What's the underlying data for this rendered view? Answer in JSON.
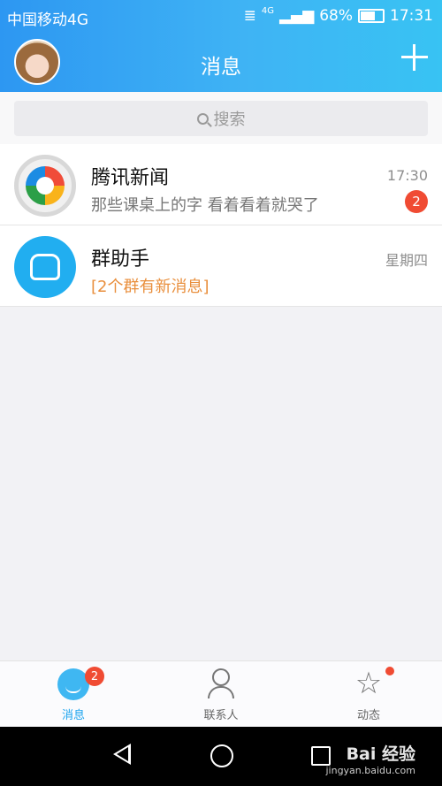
{
  "status_bar": {
    "carrier": "中国移动4G",
    "network": "4G",
    "battery": "68%",
    "time": "17:31"
  },
  "header": {
    "title": "消息"
  },
  "search": {
    "placeholder": "搜索"
  },
  "conversations": [
    {
      "name": "腾讯新闻",
      "preview": "那些课桌上的字 看着看着就哭了",
      "time": "17:30",
      "unread": "2"
    },
    {
      "name": "群助手",
      "preview": "[2个群有新消息]",
      "time": "星期四"
    }
  ],
  "tabbar": {
    "tabs": [
      {
        "label": "消息",
        "badge": "2",
        "active": true
      },
      {
        "label": "联系人"
      },
      {
        "label": "动态",
        "dot": true
      }
    ]
  },
  "watermark": {
    "text": "Bai 经验",
    "url": "jingyan.baidu.com"
  },
  "colors": {
    "accent": "#2fa8f2",
    "badge": "#f04b33",
    "highlight_text": "#e98f3d"
  }
}
